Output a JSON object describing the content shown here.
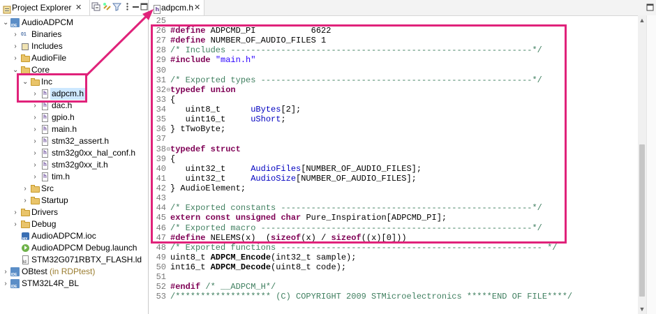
{
  "explorer": {
    "tab_title": "Project Explorer",
    "close_glyph": "✕",
    "toolbar_icons": [
      "collapse-all-icon",
      "link-with-editor-icon",
      "filter-icon",
      "view-menu-icon",
      "minimize-icon"
    ],
    "items": [
      {
        "label": "AudioADPCM",
        "icon": "project-icon",
        "expanded": true
      },
      {
        "label": "Binaries",
        "icon": "binaries-icon",
        "expanded": false
      },
      {
        "label": "Includes",
        "icon": "includes-icon",
        "expanded": false
      },
      {
        "label": "AudioFile",
        "icon": "folder-icon",
        "expanded": false
      },
      {
        "label": "Core",
        "icon": "folder-icon",
        "expanded": true
      },
      {
        "label": "Inc",
        "icon": "folder-open-icon",
        "expanded": true
      },
      {
        "label": "adpcm.h",
        "icon": "header-file-icon",
        "selected": true
      },
      {
        "label": "dac.h",
        "icon": "header-file-icon"
      },
      {
        "label": "gpio.h",
        "icon": "header-file-icon"
      },
      {
        "label": "main.h",
        "icon": "header-file-icon"
      },
      {
        "label": "stm32_assert.h",
        "icon": "header-file-icon"
      },
      {
        "label": "stm32g0xx_hal_conf.h",
        "icon": "header-file-icon"
      },
      {
        "label": "stm32g0xx_it.h",
        "icon": "header-file-icon"
      },
      {
        "label": "tim.h",
        "icon": "header-file-icon"
      },
      {
        "label": "Src",
        "icon": "folder-icon",
        "expanded": false
      },
      {
        "label": "Startup",
        "icon": "folder-icon",
        "expanded": false
      },
      {
        "label": "Drivers",
        "icon": "folder-icon",
        "expanded": false
      },
      {
        "label": "Debug",
        "icon": "folder-icon",
        "expanded": false
      },
      {
        "label": "AudioADPCM.ioc",
        "icon": "ioc-file-icon"
      },
      {
        "label": "AudioADPCM Debug.launch",
        "icon": "launch-file-icon"
      },
      {
        "label": "STM32G071RBTX_FLASH.ld",
        "icon": "linker-file-icon"
      },
      {
        "label": "OBtest",
        "suffix": " (in RDPtest)",
        "icon": "project-icon",
        "expanded": false
      },
      {
        "label": "STM32L4R_BL",
        "icon": "project-icon",
        "expanded": false
      }
    ]
  },
  "editor": {
    "tab_title": "adpcm.h",
    "close_glyph": "✕",
    "lines": [
      {
        "n": "25",
        "text": ""
      },
      {
        "n": "26",
        "text": "#define ADPCMD_PI           6622"
      },
      {
        "n": "27",
        "text": "#define NUMBER_OF_AUDIO_FILES 1"
      },
      {
        "n": "28",
        "text": "/* Includes ------------------------------------------------------------*/"
      },
      {
        "n": "29",
        "text": "#include \"main.h\""
      },
      {
        "n": "30",
        "text": ""
      },
      {
        "n": "31",
        "text": "/* Exported types ------------------------------------------------------*/"
      },
      {
        "n": "32",
        "text": "typedef union"
      },
      {
        "n": "33",
        "text": "{"
      },
      {
        "n": "34",
        "text": "   uint8_t      uBytes[2];"
      },
      {
        "n": "35",
        "text": "   uint16_t     uShort;"
      },
      {
        "n": "36",
        "text": "} tTwoByte;"
      },
      {
        "n": "37",
        "text": ""
      },
      {
        "n": "38",
        "text": "typedef struct"
      },
      {
        "n": "39",
        "text": "{"
      },
      {
        "n": "40",
        "text": "   uint32_t     AudioFiles[NUMBER_OF_AUDIO_FILES];"
      },
      {
        "n": "41",
        "text": "   uint32_t     AudioSize[NUMBER_OF_AUDIO_FILES];"
      },
      {
        "n": "42",
        "text": "} AudioElement;"
      },
      {
        "n": "43",
        "text": ""
      },
      {
        "n": "44",
        "text": "/* Exported constants --------------------------------------------------*/"
      },
      {
        "n": "45",
        "text": "extern const unsigned char Pure_Inspiration[ADPCMD_PI];"
      },
      {
        "n": "46",
        "text": "/* Exported macro ------------------------------------------------------*/"
      },
      {
        "n": "47",
        "text": "#define NELEMS(x)  (sizeof(x) / sizeof((x)[0]))"
      },
      {
        "n": "48",
        "text": "/* Exported functions ---------------------------------------------------- */"
      },
      {
        "n": "49",
        "text": "uint8_t ADPCM_Encode(int32_t sample);"
      },
      {
        "n": "50",
        "text": "int16_t ADPCM_Decode(uint8_t code);"
      },
      {
        "n": "51",
        "text": ""
      },
      {
        "n": "52",
        "text": "#endif /* __ADPCM_H*/"
      },
      {
        "n": "53",
        "text": "/******************* (C) COPYRIGHT 2009 STMicroelectronics *****END OF FILE****/"
      }
    ]
  },
  "colors": {
    "annotation": "#e0227a",
    "keyword": "#7f0055",
    "comment": "#3f7f5f",
    "string": "#2a00ff",
    "field": "#0000c0",
    "selection": "#cde8ff"
  }
}
